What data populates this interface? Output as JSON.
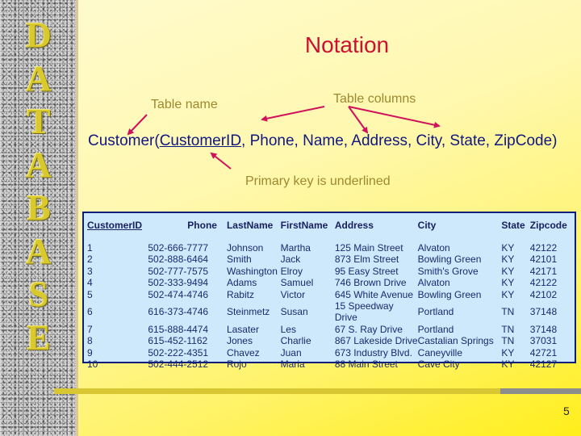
{
  "sidebar": {
    "letters": [
      "D",
      "A",
      "T",
      "A",
      "B",
      "A",
      "S",
      "E"
    ]
  },
  "slide": {
    "title": "Notation",
    "annotations": {
      "table_name": "Table name",
      "table_columns": "Table columns",
      "primary_key": "Primary key is underlined"
    },
    "notation": {
      "table": "Customer(",
      "primary_key": "CustomerID",
      "rest": ", Phone, Name, Address, City, State, ZipCode)"
    },
    "page_number": "5",
    "colors": {
      "title": "#cc1030",
      "annotation": "#9e8830",
      "arrow": "#d0105a",
      "notation_text": "#101880",
      "table_bg": "#cde9fb",
      "table_border": "#0d1e7a",
      "sidebar_letter": "#d9c92c"
    }
  },
  "table": {
    "headers": [
      "CustomerID",
      "Phone",
      "LastName",
      "FirstName",
      "Address",
      "City",
      "State",
      "Zipcode"
    ],
    "rows": [
      [
        "1",
        "502-666-7777",
        "Johnson",
        "Martha",
        "125 Main Street",
        "Alvaton",
        "KY",
        "42122"
      ],
      [
        "2",
        "502-888-6464",
        "Smith",
        "Jack",
        "873 Elm Street",
        "Bowling Green",
        "KY",
        "42101"
      ],
      [
        "3",
        "502-777-7575",
        "Washington",
        "Elroy",
        "95 Easy Street",
        "Smith's Grove",
        "KY",
        "42171"
      ],
      [
        "4",
        "502-333-9494",
        "Adams",
        "Samuel",
        "746 Brown Drive",
        "Alvaton",
        "KY",
        "42122"
      ],
      [
        "5",
        "502-474-4746",
        "Rabitz",
        "Victor",
        "645 White Avenue",
        "Bowling Green",
        "KY",
        "42102"
      ],
      [
        "6",
        "616-373-4746",
        "Steinmetz",
        "Susan",
        "15 Speedway Drive",
        "Portland",
        "TN",
        "37148"
      ],
      [
        "7",
        "615-888-4474",
        "Lasater",
        "Les",
        "67 S. Ray Drive",
        "Portland",
        "TN",
        "37148"
      ],
      [
        "8",
        "615-452-1162",
        "Jones",
        "Charlie",
        "867 Lakeside Drive",
        "Castalian Springs",
        "TN",
        "37031"
      ],
      [
        "9",
        "502-222-4351",
        "Chavez",
        "Juan",
        "673 Industry Blvd.",
        "Caneyville",
        "KY",
        "42721"
      ],
      [
        "10",
        "502-444-2512",
        "Rojo",
        "Maria",
        "88 Main Street",
        "Cave City",
        "KY",
        "42127"
      ]
    ]
  }
}
